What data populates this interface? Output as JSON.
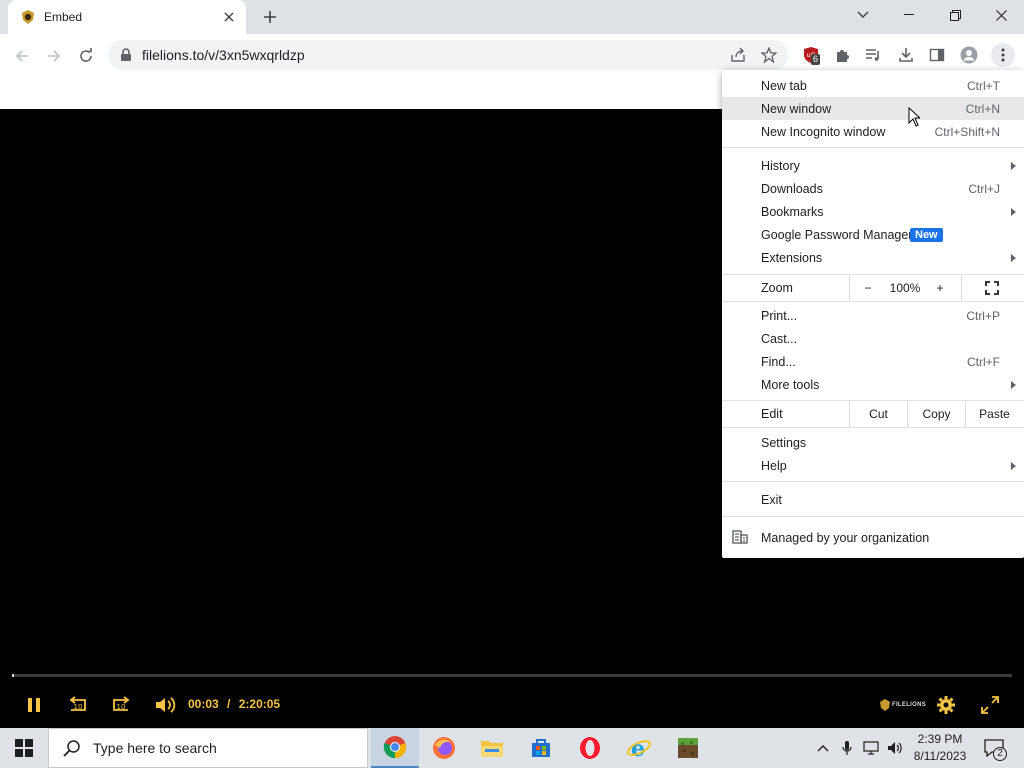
{
  "browser": {
    "tab_title": "Embed",
    "url": "filelions.to/v/3xn5wxqrldzp",
    "extension_badge": "6"
  },
  "menu": {
    "items_top": [
      {
        "label": "New tab",
        "shortcut": "Ctrl+T"
      },
      {
        "label": "New window",
        "shortcut": "Ctrl+N"
      },
      {
        "label": "New Incognito window",
        "shortcut": "Ctrl+Shift+N"
      }
    ],
    "history": "History",
    "downloads": {
      "label": "Downloads",
      "shortcut": "Ctrl+J"
    },
    "bookmarks": "Bookmarks",
    "password_manager": "Google Password Manager",
    "new_badge": "New",
    "extensions": "Extensions",
    "zoom": {
      "label": "Zoom",
      "minus": "−",
      "value": "100%",
      "plus": "+"
    },
    "print": {
      "label": "Print...",
      "shortcut": "Ctrl+P"
    },
    "cast": "Cast...",
    "find": {
      "label": "Find...",
      "shortcut": "Ctrl+F"
    },
    "more_tools": "More tools",
    "edit": {
      "label": "Edit",
      "cut": "Cut",
      "copy": "Copy",
      "paste": "Paste"
    },
    "settings": "Settings",
    "help": "Help",
    "exit": "Exit",
    "managed": "Managed by your organization"
  },
  "player": {
    "current_time": "00:03",
    "separator": "/",
    "duration": "2:20:05",
    "progress_fraction": 0.0004,
    "brand": "FILELIONS",
    "accent_color": "#f6c444"
  },
  "taskbar": {
    "search_placeholder": "Type here to search",
    "time": "2:39 PM",
    "date": "8/11/2023",
    "notification_count": "2"
  }
}
